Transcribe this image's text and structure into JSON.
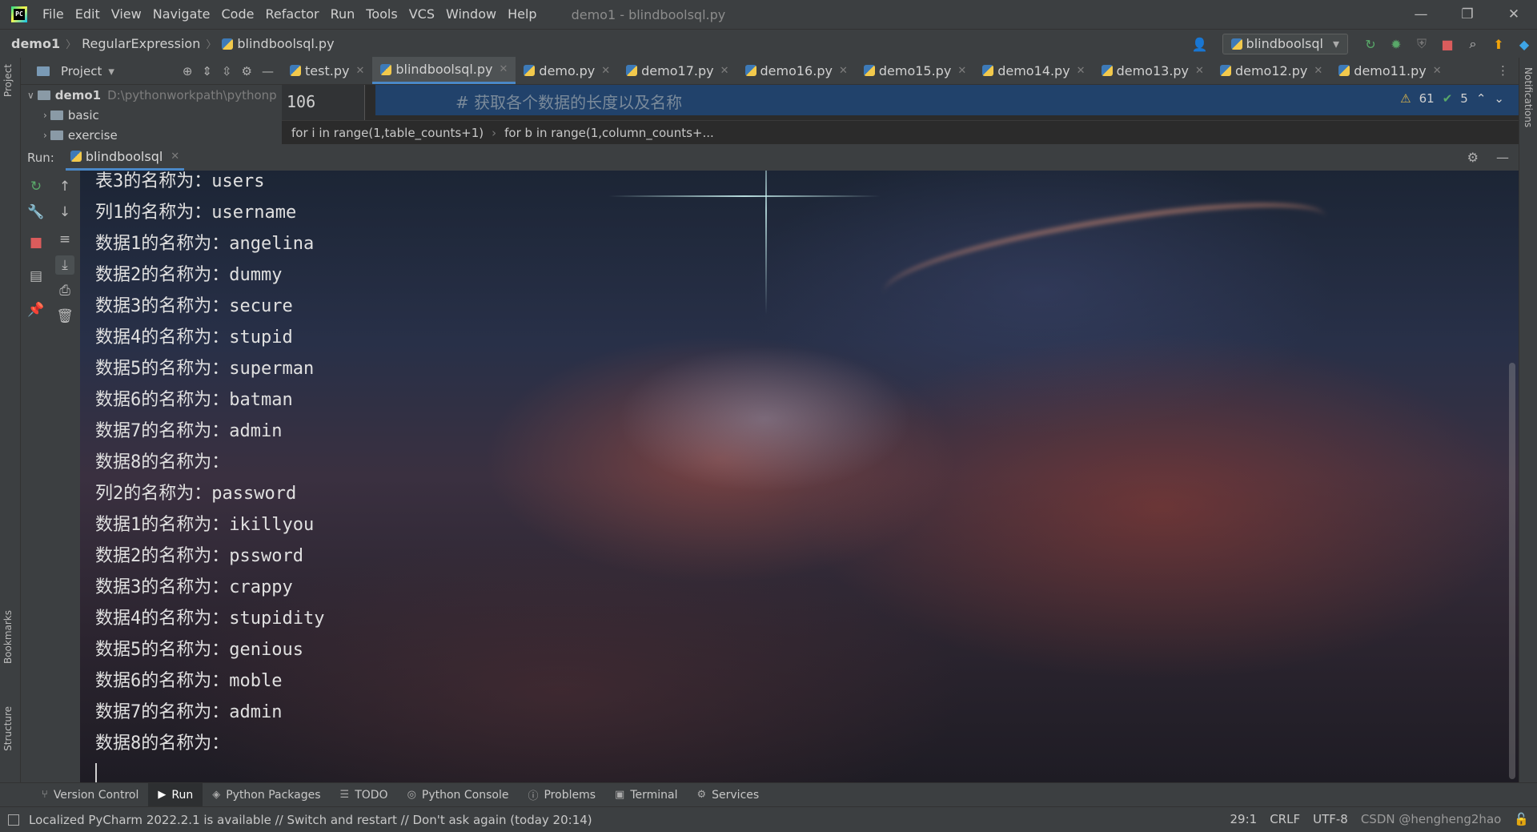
{
  "titlebar": {
    "menu": [
      "File",
      "Edit",
      "View",
      "Navigate",
      "Code",
      "Refactor",
      "Run",
      "Tools",
      "VCS",
      "Window",
      "Help"
    ],
    "window_title": "demo1 - blindboolsql.py",
    "minimize": "—",
    "restore": "❐",
    "close": "✕"
  },
  "navbar": {
    "project": "demo1",
    "folder": "RegularExpression",
    "file": "blindboolsql.py",
    "run_config": "blindboolsql"
  },
  "project_panel": {
    "title": "Project",
    "root_name": "demo1",
    "root_path": "D:\\pythonworkpath\\pythonp",
    "children": [
      "basic",
      "exercise"
    ]
  },
  "editor": {
    "tabs": [
      {
        "label": "test.py"
      },
      {
        "label": "blindboolsql.py",
        "active": true
      },
      {
        "label": "demo.py"
      },
      {
        "label": "demo17.py"
      },
      {
        "label": "demo16.py"
      },
      {
        "label": "demo15.py"
      },
      {
        "label": "demo14.py"
      },
      {
        "label": "demo13.py"
      },
      {
        "label": "demo12.py"
      },
      {
        "label": "demo11.py"
      }
    ],
    "line_number": "106",
    "code_line": "#  获取各个数据的长度以及名称",
    "warnings": "61",
    "checks": "5",
    "breadcrumbs": [
      "for i in range(1,table_counts+1)",
      "for b in range(1,column_counts+..."
    ]
  },
  "run_window": {
    "label": "Run:",
    "tab": "blindboolsql",
    "output": [
      "表3的名称为：users",
      "列1的名称为：username",
      "数据1的名称为：angelina",
      "数据2的名称为：dummy",
      "数据3的名称为：secure",
      "数据4的名称为：stupid",
      "数据5的名称为：superman",
      "数据6的名称为：batman",
      "数据7的名称为：admin",
      "数据8的名称为：",
      "列2的名称为：password",
      "数据1的名称为：ikillyou",
      "数据2的名称为：pssword",
      "数据3的名称为：crappy",
      "数据4的名称为：stupidity",
      "数据5的名称为：genious",
      "数据6的名称为：moble",
      "数据7的名称为：admin",
      "数据8的名称为："
    ]
  },
  "side_labels": {
    "project": "Project",
    "bookmarks": "Bookmarks",
    "structure": "Structure",
    "notifications": "Notifications"
  },
  "tool_tabs": [
    "Version Control",
    "Run",
    "Python Packages",
    "TODO",
    "Python Console",
    "Problems",
    "Terminal",
    "Services"
  ],
  "statusbar": {
    "message": "Localized PyCharm 2022.2.1 is available // Switch and restart // Don't ask again (today 20:14)",
    "position": "29:1",
    "line_sep": "CRLF",
    "encoding": "UTF-8",
    "watermark": "CSDN @hengheng2hao"
  },
  "colors": {
    "accent": "#4a88c7",
    "panel": "#3c3f41",
    "editor_bg": "#2b2b2b"
  }
}
